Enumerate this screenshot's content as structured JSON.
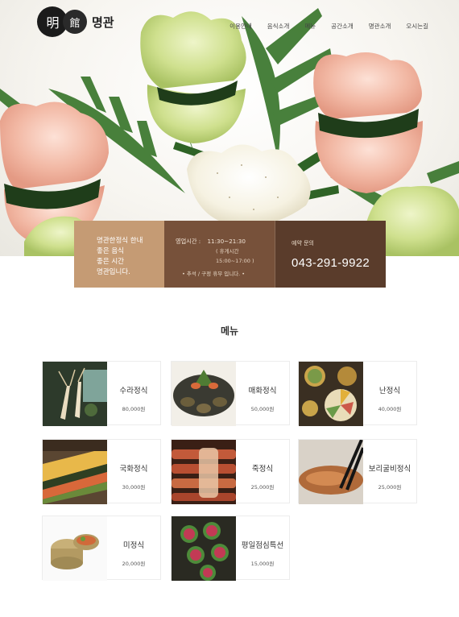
{
  "brand": {
    "seal_char_1": "明",
    "seal_char_2": "館",
    "name": "명관"
  },
  "nav": {
    "items": [
      "이용안내",
      "음식소개",
      "메뉴",
      "공간소개",
      "명관소개",
      "오시는길"
    ]
  },
  "info": {
    "intro_lines": [
      "명관한정식 한내",
      "좋은 음식",
      "좋은 시간",
      "명관입니다."
    ],
    "hours_label": "영업시간 :",
    "hours_time": "11:30~21:30",
    "hours_break": "( 휴게시간 15:00~17:00 )",
    "holiday_note": "• 추석 / 구정 휴무 입니다. •",
    "reserve_label": "예약 문의",
    "phone": "043-291-9922"
  },
  "menu": {
    "title": "메뉴",
    "items": [
      {
        "name": "수라정식",
        "price": "80,000원",
        "image": "ginseng-photo"
      },
      {
        "name": "매화정식",
        "price": "50,000원",
        "image": "abalone-photo"
      },
      {
        "name": "난정식",
        "price": "40,000원",
        "image": "table-set-photo"
      },
      {
        "name": "국화정식",
        "price": "30,000원",
        "image": "rolled-omelet-photo"
      },
      {
        "name": "죽정식",
        "price": "25,000원",
        "image": "grilled-fish-photo"
      },
      {
        "name": "보리굴비정식",
        "price": "25,000원",
        "image": "chopsticks-fish-photo"
      },
      {
        "name": "미정식",
        "price": "20,000원",
        "image": "brass-bowl-photo"
      },
      {
        "name": "평일점심특선",
        "price": "15,000원",
        "image": "cucumber-roll-photo"
      }
    ]
  },
  "colors": {
    "info_left": "#c59b74",
    "info_mid": "#77513a",
    "info_right": "#5a3c2b"
  }
}
